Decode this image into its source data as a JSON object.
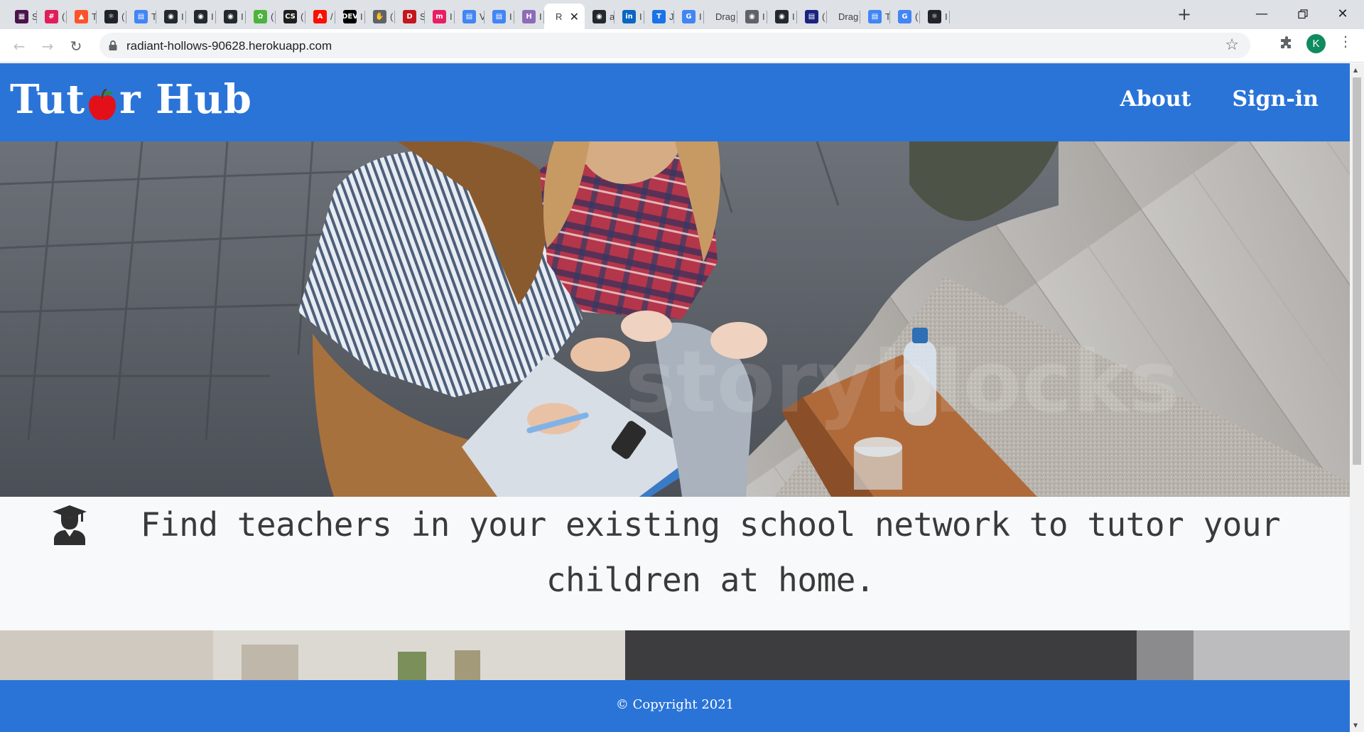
{
  "browser": {
    "tabs": [
      {
        "title": "S",
        "icon": "slack-grid-icon",
        "color": "#4a154b"
      },
      {
        "title": "(",
        "icon": "slack-icon",
        "color": "#e01e5a"
      },
      {
        "title": "T",
        "icon": "brave-icon",
        "color": "#fb542b"
      },
      {
        "title": "(",
        "icon": "react-icon",
        "color": "#20232a"
      },
      {
        "title": "T",
        "icon": "google-docs-icon",
        "color": "#4285f4"
      },
      {
        "title": "I",
        "icon": "github-icon",
        "color": "#24292e"
      },
      {
        "title": "I",
        "icon": "github-icon",
        "color": "#24292e"
      },
      {
        "title": "I",
        "icon": "github-icon",
        "color": "#24292e"
      },
      {
        "title": "(",
        "icon": "mongodb-leaf-icon",
        "color": "#4db33d"
      },
      {
        "title": "(",
        "icon": "css-icon",
        "color": "#1f1f1f"
      },
      {
        "title": "/",
        "icon": "adobe-icon",
        "color": "#fa0f00"
      },
      {
        "title": "I",
        "icon": "dev-icon",
        "color": "#000000"
      },
      {
        "title": "(",
        "icon": "hand-icon",
        "color": "#5f6368"
      },
      {
        "title": "S",
        "icon": "d-icon",
        "color": "#c4161c"
      },
      {
        "title": "I",
        "icon": "m-icon",
        "color": "#e91e63"
      },
      {
        "title": "V",
        "icon": "google-docs-icon",
        "color": "#4285f4"
      },
      {
        "title": "I",
        "icon": "google-docs-icon",
        "color": "#4285f4"
      },
      {
        "title": "I",
        "icon": "h-icon",
        "color": "#8e6bb8"
      },
      {
        "title": "R",
        "icon": "",
        "color": "#ffffff",
        "active": true
      },
      {
        "title": "a",
        "icon": "github-icon",
        "color": "#24292e"
      },
      {
        "title": "I",
        "icon": "linkedin-icon",
        "color": "#0a66c2"
      },
      {
        "title": "J",
        "icon": "t-icon",
        "color": "#1a73e8"
      },
      {
        "title": "I",
        "icon": "google-icon",
        "color": "#4285f4"
      },
      {
        "title": "Drag",
        "icon": "",
        "color": "#dee1e6"
      },
      {
        "title": "I",
        "icon": "globe-icon",
        "color": "#5f6368"
      },
      {
        "title": "I",
        "icon": "github-icon",
        "color": "#24292e"
      },
      {
        "title": "(",
        "icon": "chart-icon",
        "color": "#1a237e"
      },
      {
        "title": "Drag",
        "icon": "",
        "color": "#dee1e6"
      },
      {
        "title": "T",
        "icon": "google-docs-icon",
        "color": "#4285f4"
      },
      {
        "title": "(",
        "icon": "google-icon",
        "color": "#4285f4"
      },
      {
        "title": "I",
        "icon": "react-icon",
        "color": "#20232a"
      }
    ],
    "url": "radiant-hollows-90628.herokuapp.com",
    "avatar_letter": "K",
    "avatar_color": "#0f8b5f"
  },
  "site": {
    "brand_color": "#2a74d8",
    "logo": {
      "before": "Tut",
      "after": "r Hub"
    },
    "nav": {
      "about": "About",
      "signin": "Sign-in"
    },
    "tagline": "Find teachers in your existing school network to tutor your children at home.",
    "footer": "© Copyright 2021"
  }
}
